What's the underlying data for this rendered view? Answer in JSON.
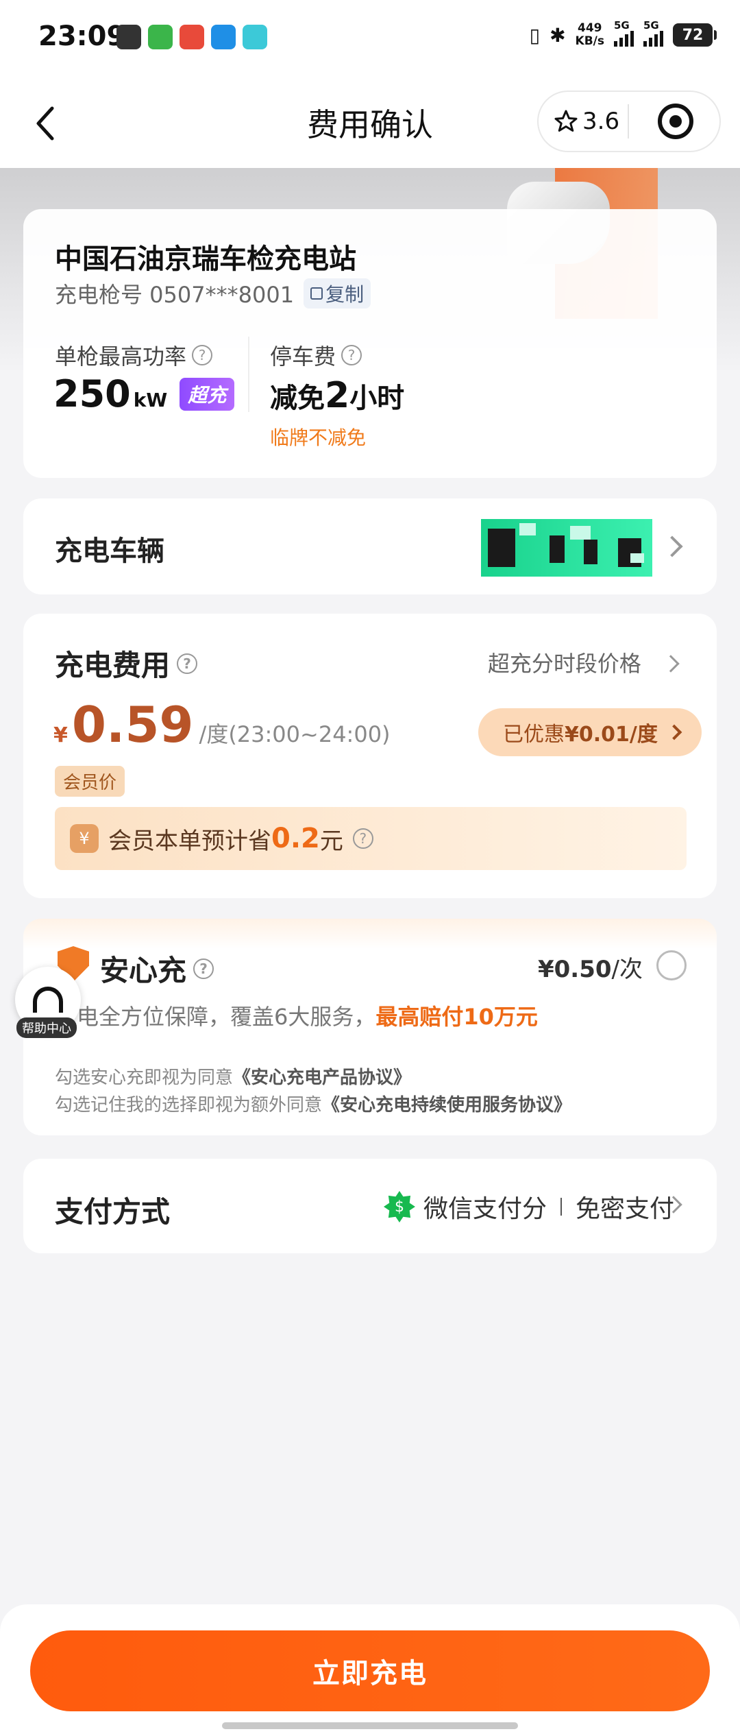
{
  "status_bar": {
    "time": "23:09",
    "net_speed_value": "449",
    "net_speed_unit": "KB/s",
    "signal1": "5G",
    "signal2": "5G",
    "battery": "72"
  },
  "nav": {
    "title": "费用确认",
    "rating": "3.6"
  },
  "station": {
    "name": "中国石油京瑞车检充电站",
    "gun_label": "充电枪号 0507***8001",
    "copy_label": "复制",
    "power_label": "单枪最高功率",
    "power_value": "250",
    "power_unit": "kW",
    "super_badge": "超充",
    "parking_label": "停车费",
    "parking_prefix": "减免",
    "parking_hours": "2",
    "parking_suffix": "小时",
    "parking_note": "临牌不减免"
  },
  "vehicle": {
    "label": "充电车辆"
  },
  "fee": {
    "title": "充电费用",
    "link": "超充分时段价格",
    "currency": "¥",
    "price": "0.59",
    "unit": "/度(23:00~24:00)",
    "discount_prefix": "已优惠",
    "discount_value": "¥0.01/度",
    "member_tag": "会员价",
    "save_prefix": "会员本单预计省",
    "save_value": "0.2",
    "save_suffix": "元"
  },
  "anxin": {
    "title": "安心充",
    "price": "¥0.50",
    "price_unit": "/次",
    "desc_prefix": "电全方位保障，覆盖6大服务，",
    "desc_highlight": "最高赔付10万元",
    "agree1_prefix": "勾选安心充即视为同意",
    "agree1_link": "《安心充电产品协议》",
    "agree2_prefix": "勾选记住我的选择即视为额外同意",
    "agree2_link": "《安心充电持续使用服务协议》"
  },
  "help": {
    "label": "帮助中心"
  },
  "payment": {
    "label": "支付方式",
    "method": "微信支付分",
    "mode": "免密支付"
  },
  "cta": {
    "label": "立即充电"
  },
  "colors": {
    "accent": "#ff5b0d",
    "price": "#b85428",
    "super_badge": "#8f4bff"
  }
}
